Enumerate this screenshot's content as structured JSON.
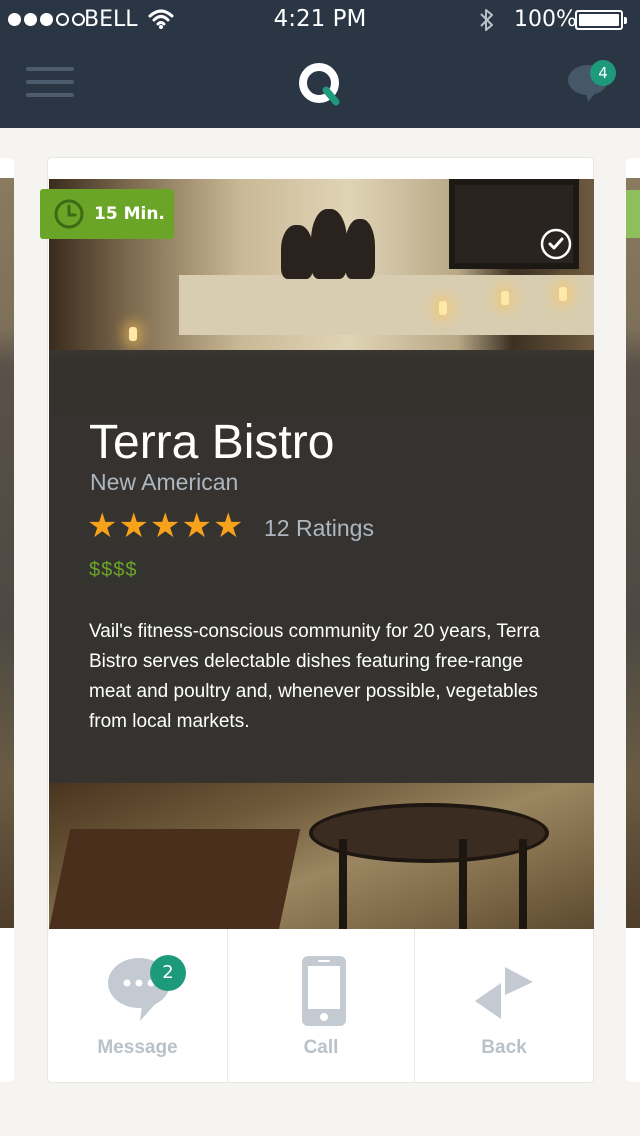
{
  "status_bar": {
    "carrier": "BELL",
    "time": "4:21 PM",
    "battery": "100%"
  },
  "nav": {
    "notification_count": "4"
  },
  "restaurant": {
    "wait_time": "15 Min.",
    "name": "Terra Bistro",
    "cuisine": "New American",
    "rating_stars": 5,
    "ratings_text": "12 Ratings",
    "price": "$$$$",
    "description": "Vail's fitness-conscious community for 20 years, Terra Bistro serves delectable dishes featuring free-range meat and poultry and, whenever possible, vegetables from local markets."
  },
  "actions": {
    "message_label": "Message",
    "message_count": "2",
    "call_label": "Call",
    "back_label": "Back"
  },
  "colors": {
    "bar": "#2a3644",
    "accent_green": "#6aa528",
    "badge_teal": "#1d9a7c",
    "star": "#f6a31b",
    "muted": "#b9c1c9"
  },
  "icons": [
    "signal-dots-icon",
    "wifi-icon",
    "bluetooth-icon",
    "battery-icon",
    "menu-icon",
    "logo-icon",
    "chat-icon",
    "clock-icon",
    "check-icon",
    "star-icon",
    "message-icon",
    "phone-icon",
    "back-icon"
  ]
}
